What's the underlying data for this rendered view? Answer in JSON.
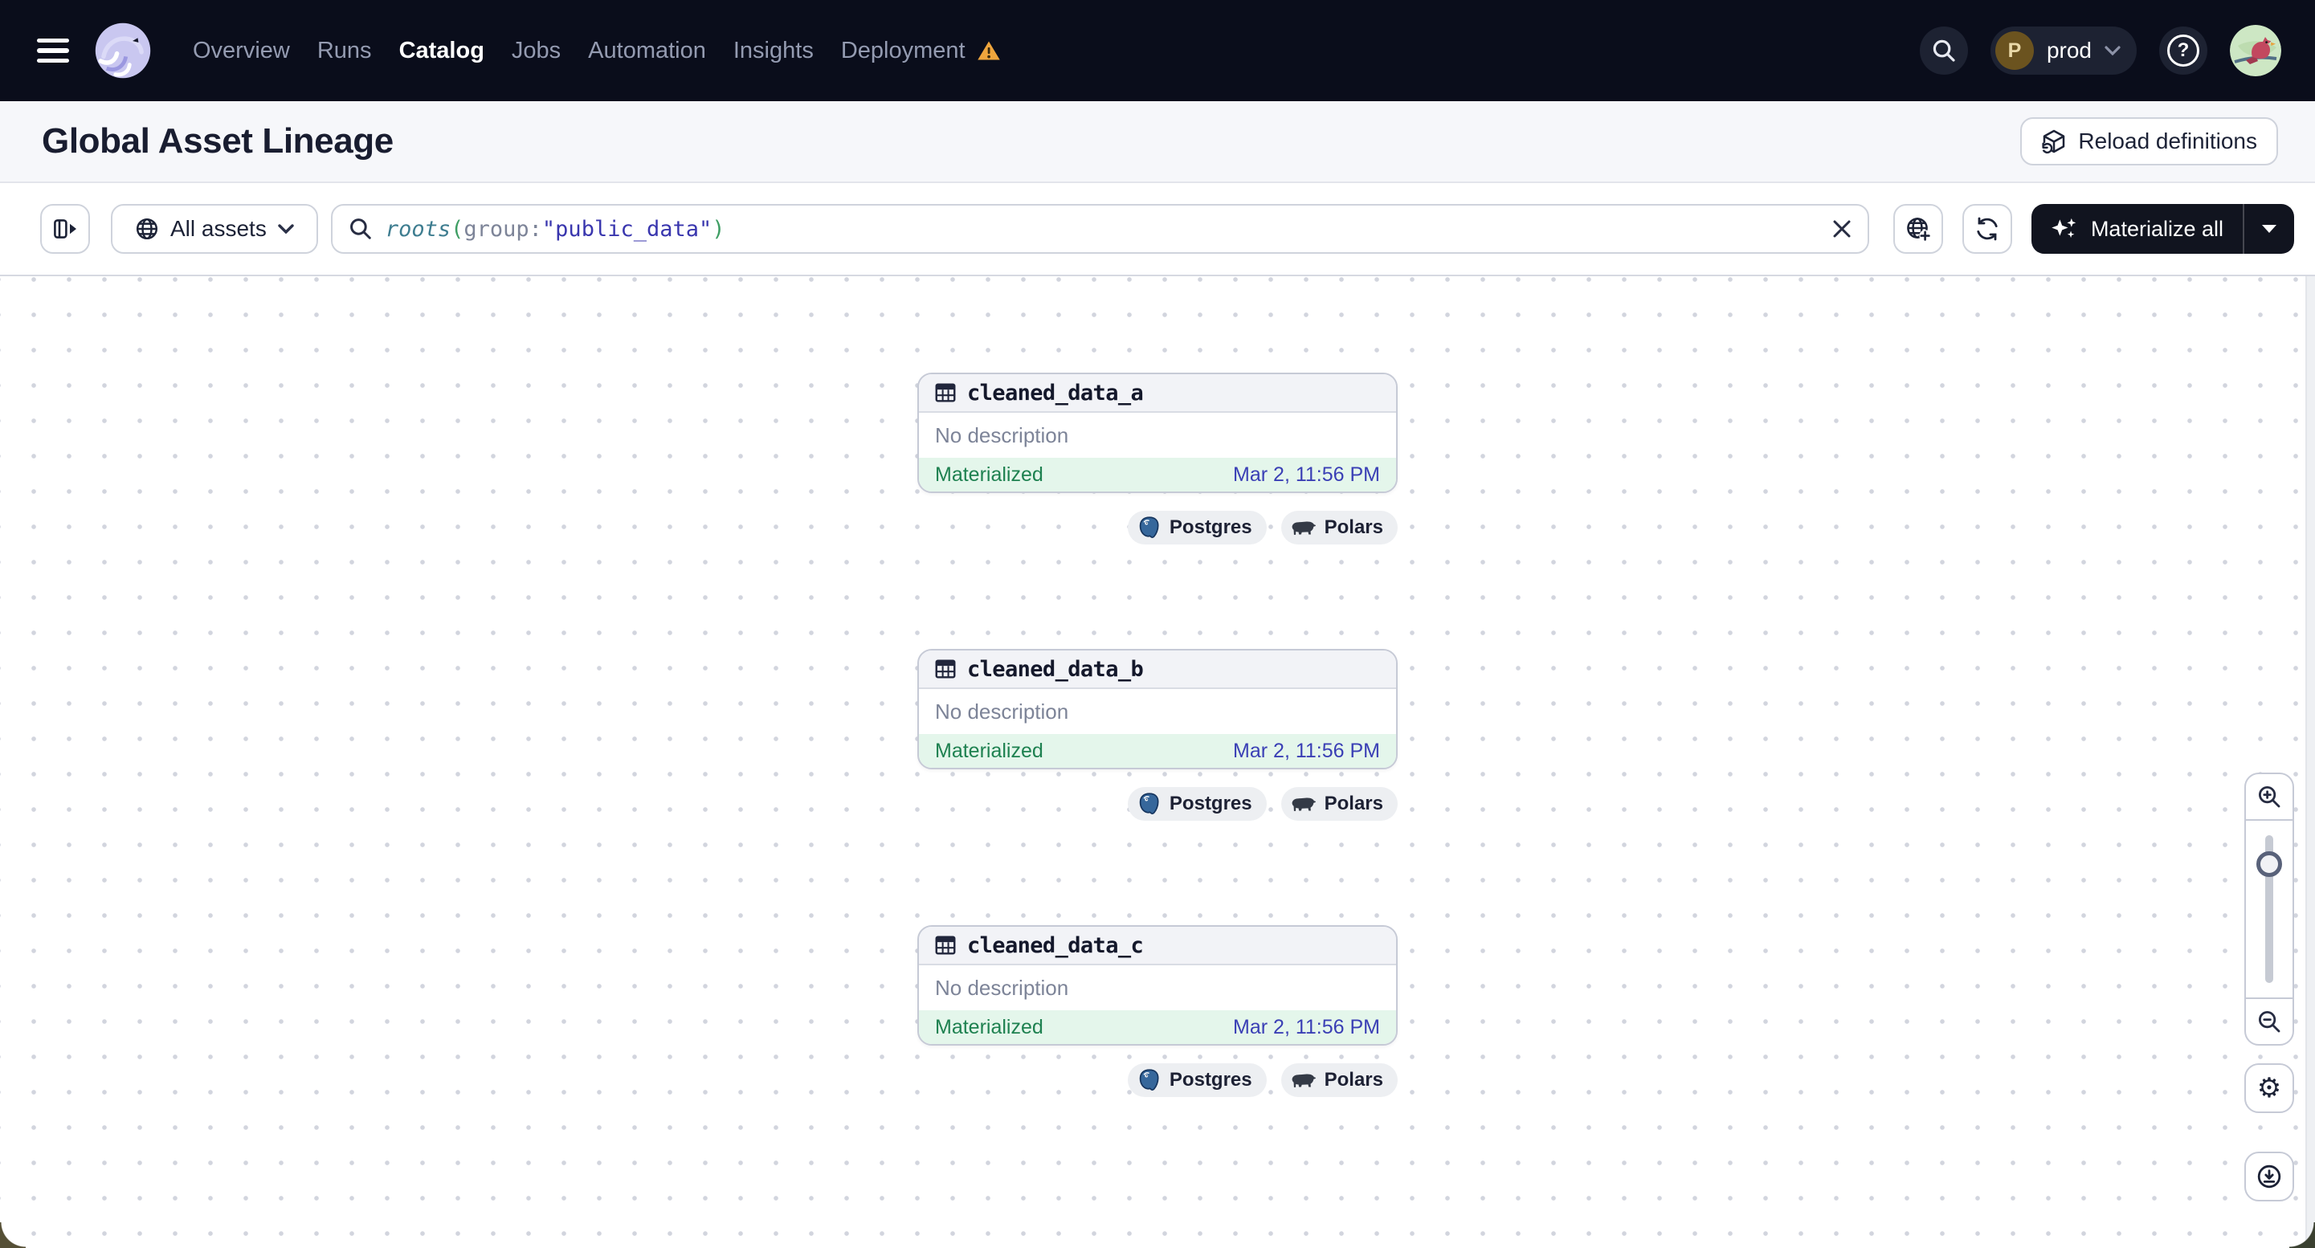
{
  "nav": {
    "items": [
      {
        "label": "Overview",
        "active": false,
        "warning": false
      },
      {
        "label": "Runs",
        "active": false,
        "warning": false
      },
      {
        "label": "Catalog",
        "active": true,
        "warning": false
      },
      {
        "label": "Jobs",
        "active": false,
        "warning": false
      },
      {
        "label": "Automation",
        "active": false,
        "warning": false
      },
      {
        "label": "Insights",
        "active": false,
        "warning": false
      },
      {
        "label": "Deployment",
        "active": false,
        "warning": true
      }
    ],
    "environment": {
      "initial": "P",
      "label": "prod"
    },
    "help_glyph": "?"
  },
  "header": {
    "title": "Global Asset Lineage",
    "reload_label": "Reload definitions"
  },
  "toolbar": {
    "scope_label": "All assets",
    "query": {
      "fn": "roots",
      "open": "(",
      "key": "group:",
      "value": "\"public_data\"",
      "close": ")"
    },
    "materialize_label": "Materialize all"
  },
  "graph": {
    "nodes": [
      {
        "name": "cleaned_data_a",
        "description": "No description",
        "status": "Materialized",
        "timestamp": "Mar 2, 11:56 PM",
        "tags": [
          "Postgres",
          "Polars"
        ]
      },
      {
        "name": "cleaned_data_b",
        "description": "No description",
        "status": "Materialized",
        "timestamp": "Mar 2, 11:56 PM",
        "tags": [
          "Postgres",
          "Polars"
        ]
      },
      {
        "name": "cleaned_data_c",
        "description": "No description",
        "status": "Materialized",
        "timestamp": "Mar 2, 11:56 PM",
        "tags": [
          "Postgres",
          "Polars"
        ]
      }
    ]
  },
  "icons": {
    "gear_glyph": "⚙"
  },
  "colors": {
    "navbar_bg": "#0a0d1b",
    "accent_green": "#1e8150",
    "status_bg": "#e4f6eb",
    "timestamp_blue": "#3a3fb5",
    "warning_orange": "#efa53d",
    "postgres_blue": "#36679b",
    "dark_button_bg": "#11141f",
    "q_fn": "#3e7d90",
    "q_paren": "#3f9e64",
    "q_str": "#3936ae"
  }
}
